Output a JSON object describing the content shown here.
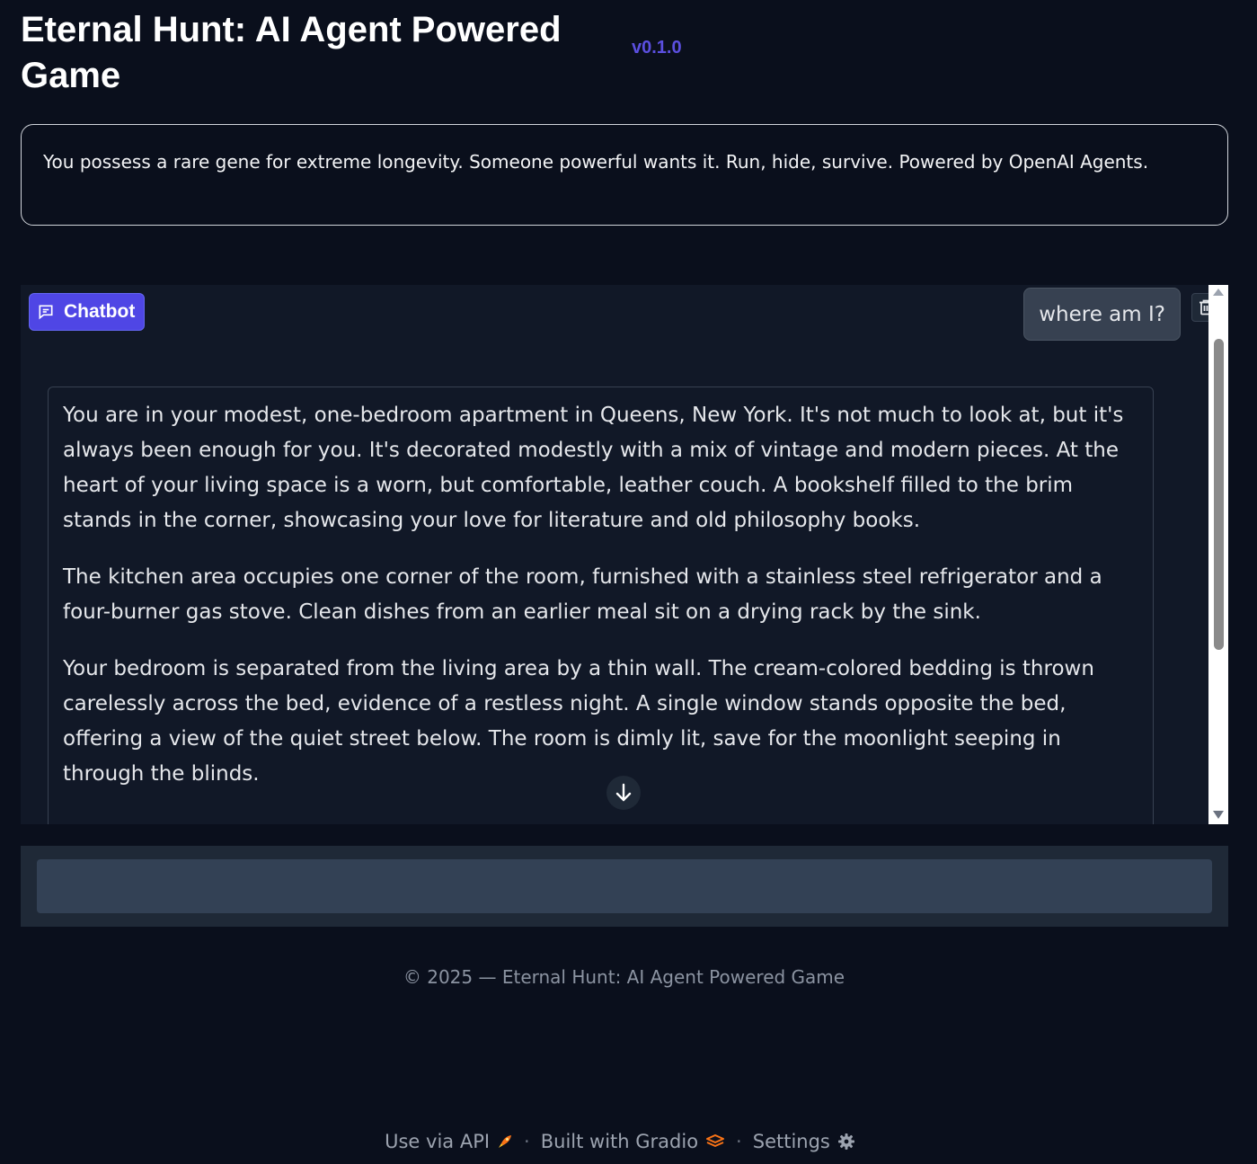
{
  "header": {
    "title": "Eternal Hunt: AI Agent Powered Game",
    "version": "v0.1.0"
  },
  "description": "You possess a rare gene for extreme longevity. Someone powerful wants it. Run, hide, survive. Powered by OpenAI Agents.",
  "chatbot": {
    "label": "Chatbot",
    "user_message": "where am I?",
    "bot_paragraphs": [
      "You are in your modest, one-bedroom apartment in Queens, New York. It's not much to look at, but it's always been enough for you. It's decorated modestly with a mix of vintage and modern pieces. At the heart of your living space is a worn, but comfortable, leather couch. A bookshelf filled to the brim stands in the corner, showcasing your love for literature and old philosophy books.",
      "The kitchen area occupies one corner of the room, furnished with a stainless steel refrigerator and a four-burner gas stove. Clean dishes from an earlier meal sit on a drying rack by the sink.",
      "Your bedroom is separated from the living area by a thin wall. The cream-colored bedding is thrown carelessly across the bed, evidence of a restless night. A single window stands opposite the bed, offering a view of the quiet street below. The room is dimly lit, save for the moonlight seeping in through the blinds."
    ]
  },
  "input": {
    "value": "",
    "placeholder": ""
  },
  "footer": {
    "copyright": "© 2025 — Eternal Hunt: AI Agent Powered Game",
    "use_api": "Use via API",
    "built_with": "Built with Gradio",
    "settings": "Settings",
    "separator": "·"
  },
  "colors": {
    "background": "#0a0f1c",
    "accent": "#4f46e5",
    "version": "#5b4fe0",
    "panel": "#111827"
  },
  "icons": {
    "chatbot": "chat-bubble-icon",
    "clear": "trash-icon",
    "scroll_down": "arrow-down-icon",
    "api": "rocket-icon",
    "gradio": "gradio-logo-icon",
    "settings": "gear-icon"
  }
}
